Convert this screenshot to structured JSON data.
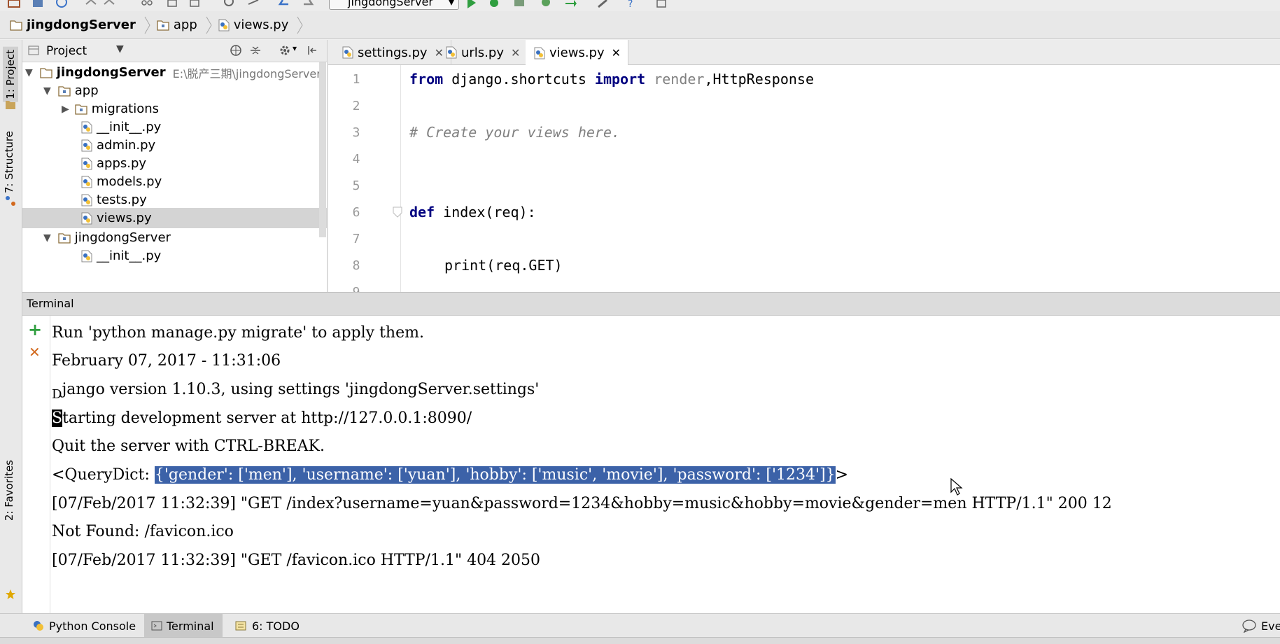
{
  "toolbar": {
    "run_config": "jingdongServer"
  },
  "breadcrumb": [
    "jingdongServer",
    "app",
    "views.py"
  ],
  "sidebar": {
    "project_tab": "1: Project",
    "structure_tab": "7: Structure",
    "favorites_tab": "2: Favorites"
  },
  "project": {
    "header": "Project",
    "root": {
      "name": "jingdongServer",
      "path": "E:\\脱产三期\\jingdongServer"
    },
    "items": [
      "app",
      "migrations",
      "__init__.py",
      "admin.py",
      "apps.py",
      "models.py",
      "tests.py",
      "views.py",
      "jingdongServer",
      "__init__.py"
    ]
  },
  "editor": {
    "tabs": [
      "settings.py",
      "urls.py",
      "views.py"
    ],
    "active_tab": "views.py",
    "line_numbers": [
      "1",
      "2",
      "3",
      "4",
      "5",
      "6",
      "7",
      "8",
      "9"
    ],
    "line1": {
      "kw1": "from",
      "mod": " django.shortcuts ",
      "kw2": "import",
      "unused": " render",
      "rest": ",HttpResponse"
    },
    "line3": "# Create your views here.",
    "line6": {
      "kw": "def",
      "rest": " index(req):"
    },
    "line8": "print(req.GET)"
  },
  "terminal": {
    "title": "Terminal",
    "lines": [
      "Run 'python manage.py migrate' to apply them.",
      "February 07, 2017 - 11:31:06",
      "Django version 1.10.3, using settings 'jingdongServer.settings'",
      "Starting development server at http://127.0.0.1:8090/",
      "Quit the server with CTRL-BREAK.",
      "[07/Feb/2017 11:32:39] \"GET /index?username=yuan&password=1234&hobby=music&hobby=movie&gender=men HTTP/1.1\" 200 12",
      "Not Found: /favicon.ico",
      "[07/Feb/2017 11:32:39] \"GET /favicon.ico HTTP/1.1\" 404 2050"
    ],
    "line3_first": "D",
    "line3_rest": "jango version 1.10.3, using settings 'jingdongServer.settings'",
    "line4_first": "S",
    "line4_rest": "tarting development server at http://127.0.0.1:8090/",
    "querydict_prefix": "<QueryDict: ",
    "querydict_selected": "{'gender': ['men'], 'username': ['yuan'], 'hobby': ['music', 'movie'], 'password': ['1234']}",
    "querydict_suffix": ">"
  },
  "bottom_tabs": [
    "Python Console",
    "Terminal",
    "6: TODO"
  ],
  "bottom_right": "Eve",
  "colors": {
    "selection": "#3c62a8",
    "keyword": "#000080",
    "comment": "#808080"
  }
}
